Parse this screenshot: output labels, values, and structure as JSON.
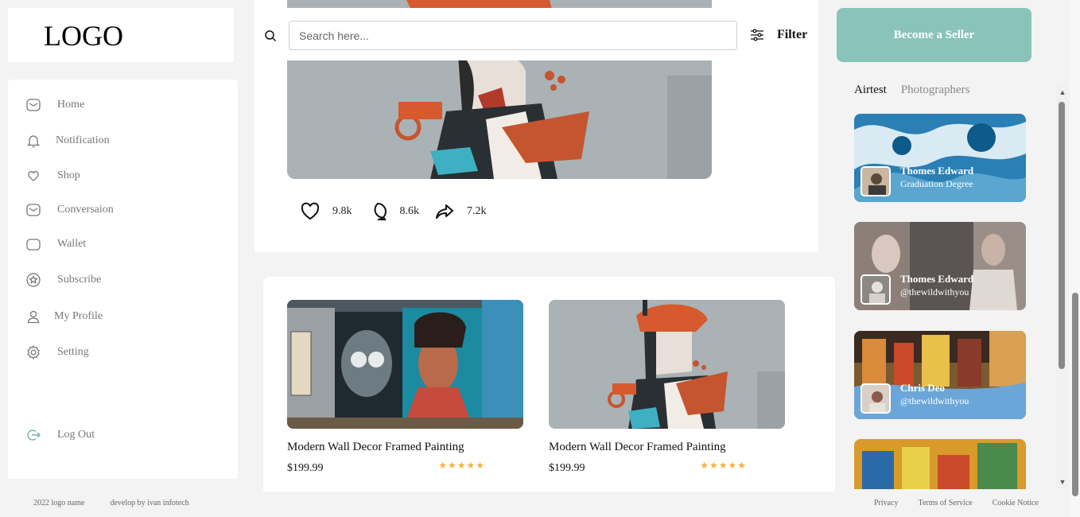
{
  "logo": "LOGO",
  "sidebar": {
    "items": [
      {
        "label": "Home",
        "icon": "home-icon"
      },
      {
        "label": "Notification",
        "icon": "bell-icon"
      },
      {
        "label": "Shop",
        "icon": "heart-icon"
      },
      {
        "label": "Conversaion",
        "icon": "mail-icon"
      },
      {
        "label": "Wallet",
        "icon": "wallet-icon"
      },
      {
        "label": "Subscribe",
        "icon": "star-badge-icon"
      },
      {
        "label": "My Profile",
        "icon": "user-icon"
      },
      {
        "label": "Setting",
        "icon": "gear-icon"
      }
    ],
    "logout": "Log Out"
  },
  "search": {
    "placeholder": "Search here...",
    "filter_label": "Filter"
  },
  "post": {
    "likes": "9.8k",
    "comments": "8.6k",
    "shares": "7.2k"
  },
  "products": [
    {
      "title": "Modern Wall Decor Framed Painting",
      "price": "$199.99",
      "rating": 5
    },
    {
      "title": "Modern Wall Decor Framed Painting",
      "price": "$199.99",
      "rating": 5
    }
  ],
  "seller_button": "Become a Seller",
  "tabs": {
    "active": "Airtest",
    "inactive": "Photographers"
  },
  "artists": [
    {
      "name": "Thomes Edward",
      "sub": "Graduation Degree"
    },
    {
      "name": "Thomes Edward",
      "sub": "@thewildwithyou"
    },
    {
      "name": "Chris Deo",
      "sub": "@thewildwithyou"
    }
  ],
  "footer": {
    "copyright": "2022 logo name",
    "developer": "develop by ivan infotech",
    "privacy": "Privacy",
    "terms": "Terms of Service",
    "cookie": "Cookie Notice"
  },
  "colors": {
    "accent": "#89c3b9",
    "star": "#f2b33d"
  }
}
